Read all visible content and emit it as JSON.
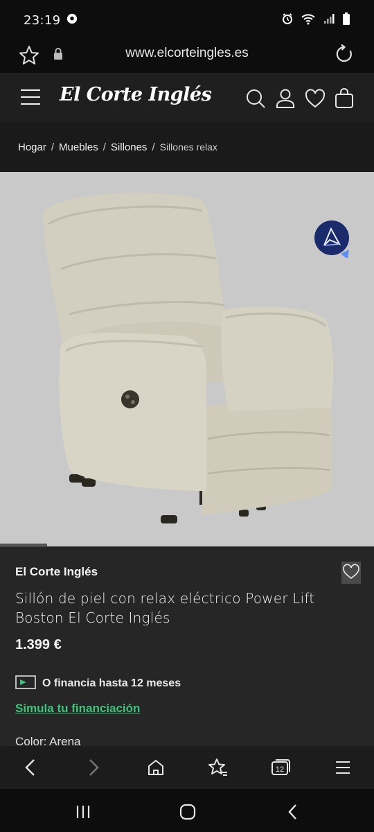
{
  "status_bar": {
    "time": "23:19",
    "icons": [
      "soccer-ball-icon",
      "alarm-icon",
      "wifi-icon",
      "signal-icon",
      "battery-icon"
    ]
  },
  "browser": {
    "url": "www.elcorteingles.es",
    "icons": [
      "star-icon",
      "lock-icon",
      "reload-icon"
    ]
  },
  "header": {
    "logo_text": "El Corte Inglés",
    "icons": [
      "menu-icon",
      "search-icon",
      "user-icon",
      "heart-icon",
      "bag-icon"
    ]
  },
  "breadcrumb": {
    "items": [
      "Hogar",
      "Muebles",
      "Sillones"
    ],
    "current": "Sillones relax",
    "separator": "/"
  },
  "product": {
    "brand": "El Corte Inglés",
    "title": "Sillón de piel con relax eléctrico Power Lift Boston El Corte Inglés",
    "price": "1.399 €",
    "finance_text": "O financia hasta 12 meses",
    "finance_link": "Simula tu financiación",
    "color_label": "Color: Arena",
    "image_bg": "#c9c9c9",
    "chair_color": "#d3cfc0"
  },
  "toolbar": {
    "tabs_count": "12",
    "icons": [
      "back-icon",
      "forward-icon",
      "home-icon",
      "bookmarks-icon",
      "tabs-icon",
      "menu-icon"
    ]
  },
  "nav_bar": {
    "icons": [
      "recents-icon",
      "home-circle-icon",
      "nav-back-icon"
    ]
  },
  "colors": {
    "accent_green": "#3ec47a",
    "header_bg": "#1f1f1f",
    "info_bg": "#262626"
  }
}
